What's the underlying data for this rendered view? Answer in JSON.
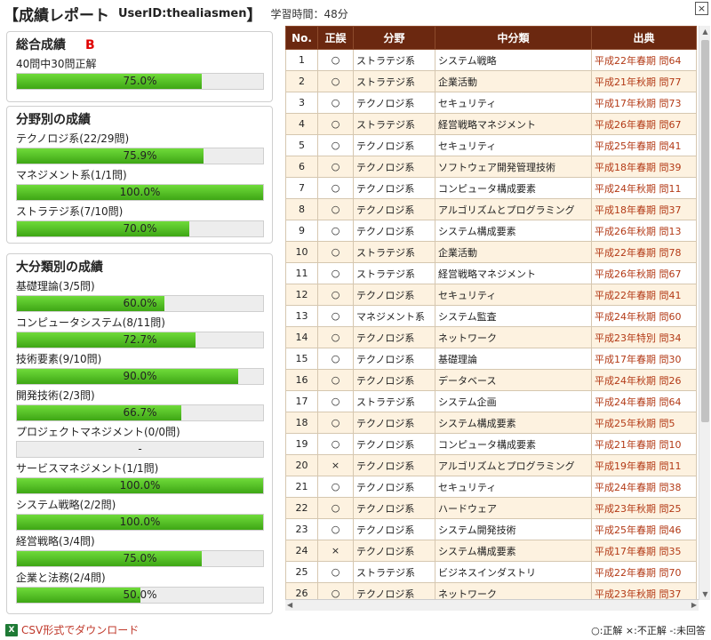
{
  "header": {
    "title": "【成績レポート",
    "user_id": "UserID:thealiasmen",
    "bracket_close": "】",
    "study_time": "学習時間：48分",
    "close_label": "×"
  },
  "overall": {
    "title": "総合成績",
    "grade": "B",
    "summary": "40問中30問正解",
    "percent_value": 75.0,
    "percent_text": "75.0%"
  },
  "field_section": {
    "title": "分野別の成績",
    "items": [
      {
        "label": "テクノロジ系(22/29問)",
        "value": 75.9,
        "text": "75.9%"
      },
      {
        "label": "マネジメント系(1/1問)",
        "value": 100.0,
        "text": "100.0%"
      },
      {
        "label": "ストラテジ系(7/10問)",
        "value": 70.0,
        "text": "70.0%"
      }
    ]
  },
  "category_section": {
    "title": "大分類別の成績",
    "items": [
      {
        "label": "基礎理論(3/5問)",
        "value": 60.0,
        "text": "60.0%"
      },
      {
        "label": "コンピュータシステム(8/11問)",
        "value": 72.7,
        "text": "72.7%"
      },
      {
        "label": "技術要素(9/10問)",
        "value": 90.0,
        "text": "90.0%"
      },
      {
        "label": "開発技術(2/3問)",
        "value": 66.7,
        "text": "66.7%"
      },
      {
        "label": "プロジェクトマネジメント(0/0問)",
        "value": 0,
        "text": "-"
      },
      {
        "label": "サービスマネジメント(1/1問)",
        "value": 100.0,
        "text": "100.0%"
      },
      {
        "label": "システム戦略(2/2問)",
        "value": 100.0,
        "text": "100.0%"
      },
      {
        "label": "経営戦略(3/4問)",
        "value": 75.0,
        "text": "75.0%"
      },
      {
        "label": "企業と法務(2/4問)",
        "value": 50.0,
        "text": "50.0%"
      }
    ]
  },
  "table": {
    "headers": [
      "No.",
      "正誤",
      "分野",
      "中分類",
      "出典"
    ],
    "rows": [
      [
        "1",
        "○",
        "ストラテジ系",
        "システム戦略",
        "平成22年春期 問64"
      ],
      [
        "2",
        "○",
        "ストラテジ系",
        "企業活動",
        "平成21年秋期 問77"
      ],
      [
        "3",
        "○",
        "テクノロジ系",
        "セキュリティ",
        "平成17年秋期 問73"
      ],
      [
        "4",
        "○",
        "ストラテジ系",
        "経営戦略マネジメント",
        "平成26年春期 問67"
      ],
      [
        "5",
        "○",
        "テクノロジ系",
        "セキュリティ",
        "平成25年春期 問41"
      ],
      [
        "6",
        "○",
        "テクノロジ系",
        "ソフトウェア開発管理技術",
        "平成18年春期 問39"
      ],
      [
        "7",
        "○",
        "テクノロジ系",
        "コンピュータ構成要素",
        "平成24年秋期 問11"
      ],
      [
        "8",
        "○",
        "テクノロジ系",
        "アルゴリズムとプログラミング",
        "平成18年春期 問37"
      ],
      [
        "9",
        "○",
        "テクノロジ系",
        "システム構成要素",
        "平成26年秋期 問13"
      ],
      [
        "10",
        "○",
        "ストラテジ系",
        "企業活動",
        "平成22年春期 問78"
      ],
      [
        "11",
        "○",
        "ストラテジ系",
        "経営戦略マネジメント",
        "平成26年秋期 問67"
      ],
      [
        "12",
        "○",
        "テクノロジ系",
        "セキュリティ",
        "平成22年春期 問41"
      ],
      [
        "13",
        "○",
        "マネジメント系",
        "システム監査",
        "平成24年秋期 問60"
      ],
      [
        "14",
        "○",
        "テクノロジ系",
        "ネットワーク",
        "平成23年特別 問34"
      ],
      [
        "15",
        "○",
        "テクノロジ系",
        "基礎理論",
        "平成17年春期 問30"
      ],
      [
        "16",
        "○",
        "テクノロジ系",
        "データベース",
        "平成24年秋期 問26"
      ],
      [
        "17",
        "○",
        "ストラテジ系",
        "システム企画",
        "平成24年春期 問64"
      ],
      [
        "18",
        "○",
        "テクノロジ系",
        "システム構成要素",
        "平成25年秋期 問5"
      ],
      [
        "19",
        "○",
        "テクノロジ系",
        "コンピュータ構成要素",
        "平成21年春期 問10"
      ],
      [
        "20",
        "×",
        "テクノロジ系",
        "アルゴリズムとプログラミング",
        "平成19年春期 問11"
      ],
      [
        "21",
        "○",
        "テクノロジ系",
        "セキュリティ",
        "平成24年春期 問38"
      ],
      [
        "22",
        "○",
        "テクノロジ系",
        "ハードウェア",
        "平成23年秋期 問25"
      ],
      [
        "23",
        "○",
        "テクノロジ系",
        "システム開発技術",
        "平成25年春期 問46"
      ],
      [
        "24",
        "×",
        "テクノロジ系",
        "システム構成要素",
        "平成17年春期 問35"
      ],
      [
        "25",
        "○",
        "ストラテジ系",
        "ビジネスインダストリ",
        "平成22年春期 問70"
      ],
      [
        "26",
        "○",
        "テクノロジ系",
        "ネットワーク",
        "平成23年秋期 問37"
      ]
    ]
  },
  "footer": {
    "csv_icon": "X",
    "csv_link": "CSV形式でダウンロード",
    "legend": "○:正解 ×:不正解 -:未回答"
  },
  "colors": {
    "table_header": "#6b2810",
    "row_alt": "#fdf2e0",
    "bar_fill": "#4cbf1e",
    "grade": "#e00000",
    "source_text": "#b33a16"
  }
}
